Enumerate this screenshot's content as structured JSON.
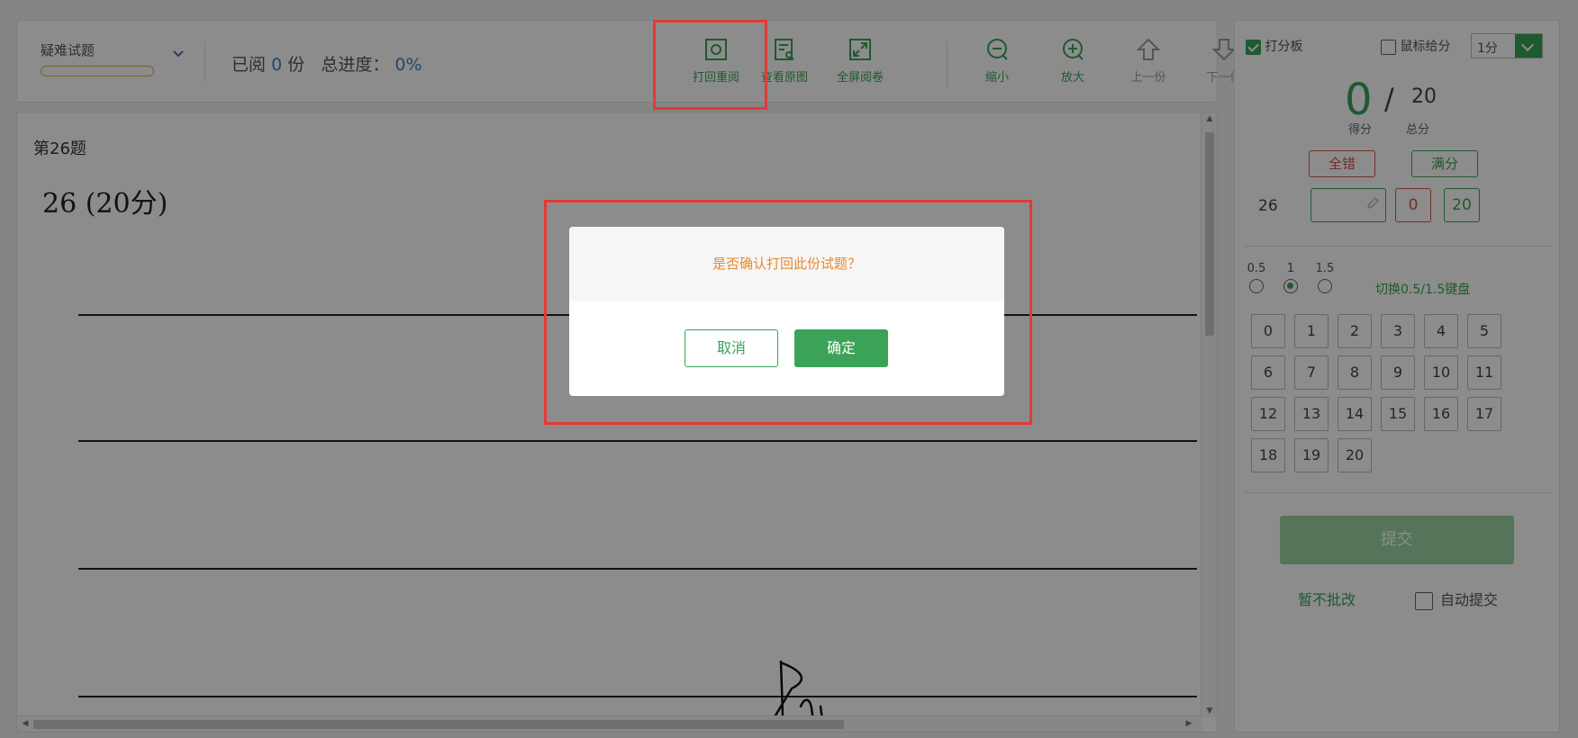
{
  "toolbar": {
    "filter_label": "疑难试题",
    "read_prefix": "已阅",
    "read_count": "0",
    "read_suffix": "份",
    "progress_label": "总进度：",
    "progress_value": "0%",
    "tools": [
      {
        "label": "打回重阅",
        "icon": "recall-icon",
        "state": "enabled"
      },
      {
        "label": "查看原图",
        "icon": "view-original-icon",
        "state": "enabled"
      },
      {
        "label": "全屏阅卷",
        "icon": "fullscreen-icon",
        "state": "enabled"
      },
      {
        "label": "缩小",
        "icon": "zoom-out-icon",
        "state": "enabled"
      },
      {
        "label": "放大",
        "icon": "zoom-in-icon",
        "state": "enabled"
      },
      {
        "label": "上一份",
        "icon": "arrow-up-icon",
        "state": "disabled"
      },
      {
        "label": "下一份",
        "icon": "arrow-down-icon",
        "state": "disabled"
      }
    ]
  },
  "document": {
    "question_title": "第26题",
    "question_score": "26 (20分)"
  },
  "panel": {
    "score_pad_label": "打分板",
    "score_pad_checked": true,
    "mouse_score_label": "鼠标给分",
    "mouse_score_checked": false,
    "unit_value": "1分",
    "score": "0",
    "total": "20",
    "score_caption": "得分",
    "total_caption": "总分",
    "all_wrong_label": "全错",
    "full_score_label": "满分",
    "question_number": "26",
    "quick_min": "0",
    "quick_max": "20",
    "step_options": [
      "0.5",
      "1",
      "1.5"
    ],
    "step_selected": "1",
    "switch_label": "切换0.5/1.5键盘",
    "score_keys": [
      "0",
      "1",
      "2",
      "3",
      "4",
      "5",
      "6",
      "7",
      "8",
      "9",
      "10",
      "11",
      "12",
      "13",
      "14",
      "15",
      "16",
      "17",
      "18",
      "19",
      "20"
    ],
    "submit_label": "提交",
    "hold_label": "暂不批改",
    "auto_submit_label": "自动提交",
    "auto_submit_checked": false
  },
  "dialog": {
    "message": "是否确认打回此份试题？",
    "cancel_label": "取消",
    "confirm_label": "确定"
  },
  "colors": {
    "accent_green": "#3aa357",
    "warning_orange": "#e78a2c",
    "danger_red": "#d9534f",
    "info_blue": "#3d86c6",
    "highlight_red": "#e53935"
  }
}
